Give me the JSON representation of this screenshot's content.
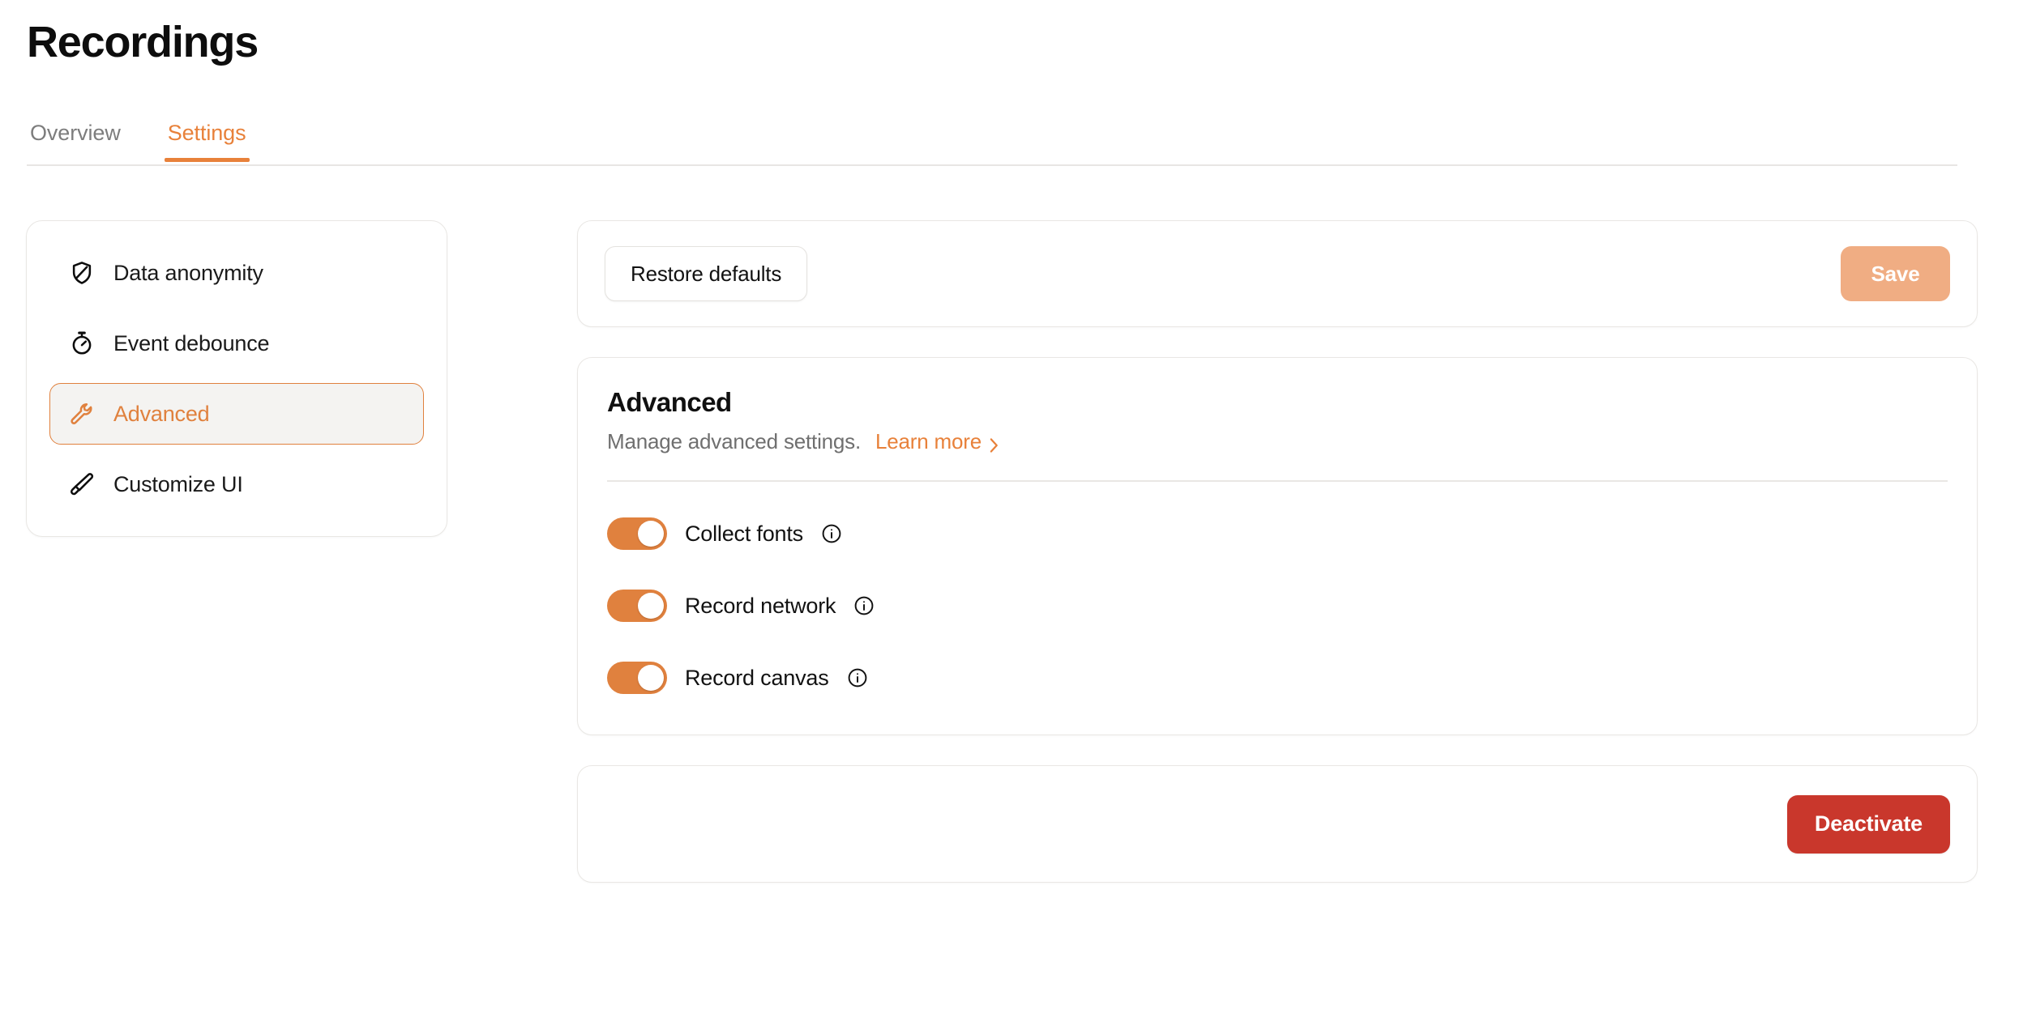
{
  "header": {
    "title": "Recordings",
    "tabs": [
      {
        "label": "Overview",
        "active": false
      },
      {
        "label": "Settings",
        "active": true
      }
    ]
  },
  "sidebar": {
    "items": [
      {
        "label": "Data anonymity",
        "icon": "shield-off-icon",
        "active": false
      },
      {
        "label": "Event debounce",
        "icon": "stopwatch-icon",
        "active": false
      },
      {
        "label": "Advanced",
        "icon": "wrench-icon",
        "active": true
      },
      {
        "label": "Customize UI",
        "icon": "paintbrush-icon",
        "active": false
      }
    ]
  },
  "actions": {
    "restore_label": "Restore defaults",
    "save_label": "Save"
  },
  "advanced": {
    "title": "Advanced",
    "description": "Manage advanced settings.",
    "learn_more_label": "Learn more",
    "toggles": [
      {
        "label": "Collect fonts",
        "state": "on",
        "info": "info-icon"
      },
      {
        "label": "Record network",
        "state": "on",
        "info": "info-icon"
      },
      {
        "label": "Record canvas",
        "state": "on",
        "info": "info-icon"
      }
    ]
  },
  "danger": {
    "deactivate_label": "Deactivate"
  },
  "colors": {
    "accent": "#e8813a",
    "accent_toggle": "#e0813e",
    "save_disabled": "#f0ad83",
    "danger": "#c9372c",
    "border": "#e9e7e4",
    "active_bg": "#f4f3f1",
    "text": "#121212",
    "muted": "#6f6f6f"
  }
}
